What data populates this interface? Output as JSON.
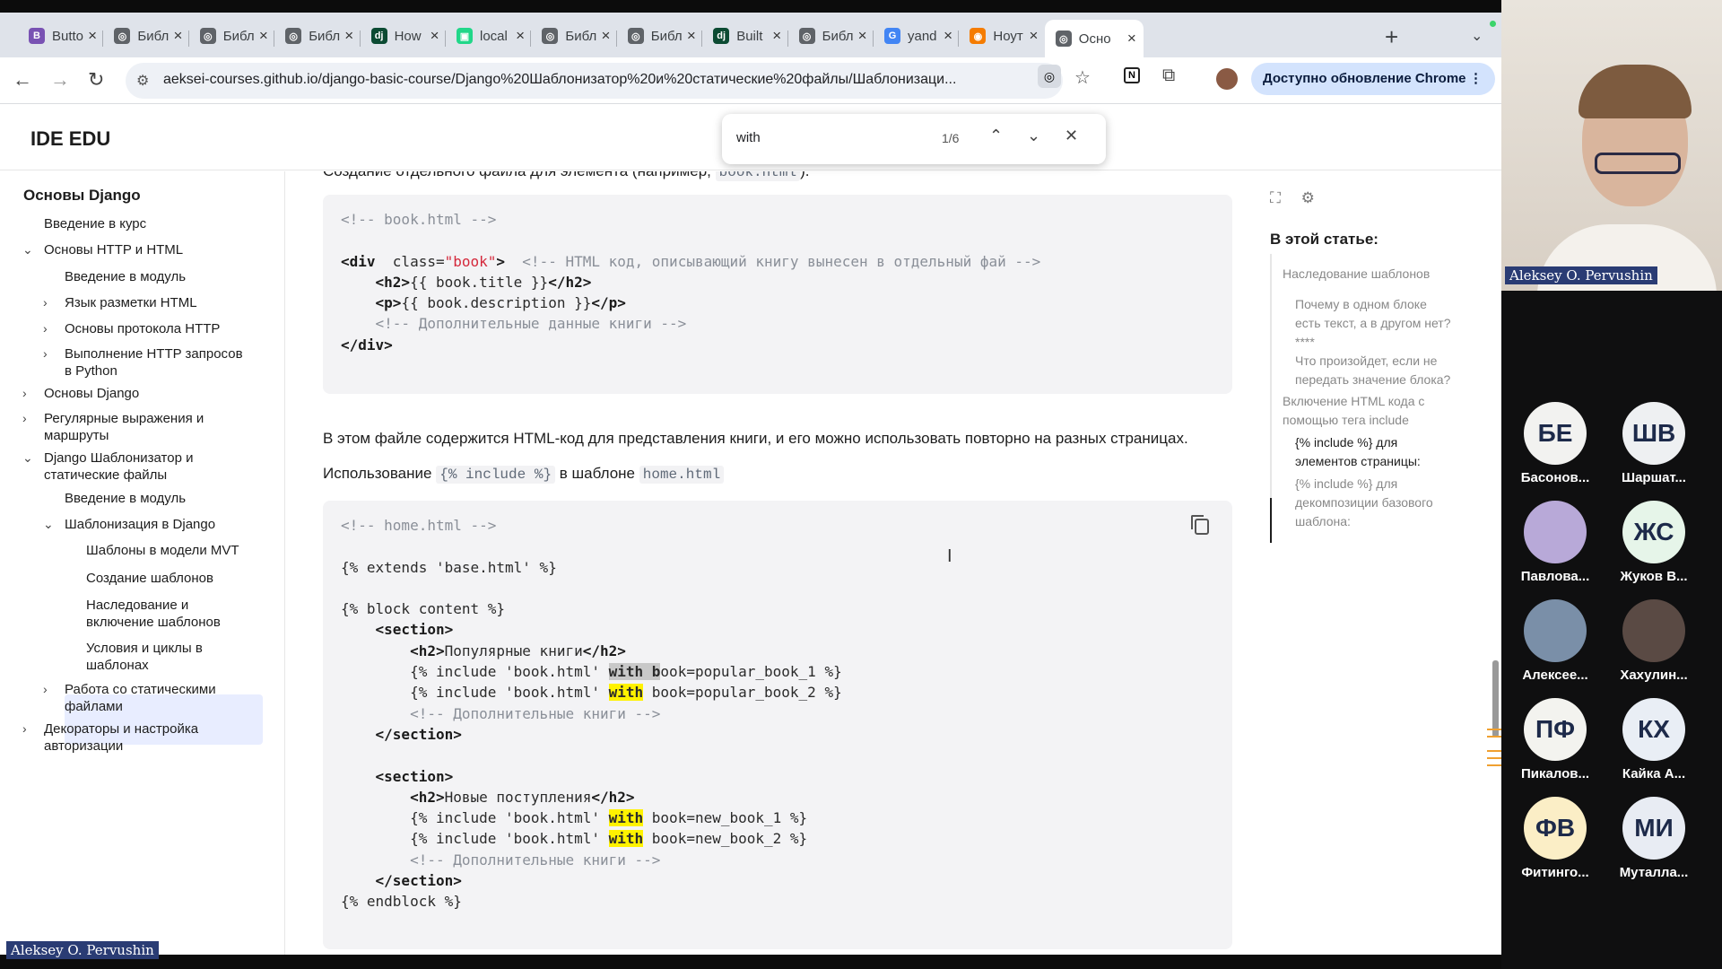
{
  "browser": {
    "tabs": [
      {
        "label": "Butto",
        "icon": "bootstrap-icon",
        "color": "#7952b3",
        "glyph": "B"
      },
      {
        "label": "Библ",
        "icon": "globe-icon",
        "color": "#5f6368",
        "glyph": "◎"
      },
      {
        "label": "Библ",
        "icon": "globe-icon",
        "color": "#5f6368",
        "glyph": "◎"
      },
      {
        "label": "Библ",
        "icon": "globe-icon",
        "color": "#5f6368",
        "glyph": "◎"
      },
      {
        "label": "How",
        "icon": "django-icon",
        "color": "#0c4b33",
        "glyph": "dj"
      },
      {
        "label": "local",
        "icon": "pycharm-icon",
        "color": "#21d789",
        "glyph": "▣"
      },
      {
        "label": "Библ",
        "icon": "globe-icon",
        "color": "#5f6368",
        "glyph": "◎"
      },
      {
        "label": "Библ",
        "icon": "globe-icon",
        "color": "#5f6368",
        "glyph": "◎"
      },
      {
        "label": "Built",
        "icon": "django-icon",
        "color": "#0c4b33",
        "glyph": "dj"
      },
      {
        "label": "Библ",
        "icon": "globe-icon",
        "color": "#5f6368",
        "glyph": "◎"
      },
      {
        "label": "yand",
        "icon": "google-icon",
        "color": "#4285f4",
        "glyph": "G"
      },
      {
        "label": "Ноут",
        "icon": "notebook-icon",
        "color": "#f57c00",
        "glyph": "◉"
      },
      {
        "label": "Осно",
        "icon": "globe-icon",
        "color": "#5f6368",
        "glyph": "◎",
        "active": true
      }
    ],
    "url": "aeksei-courses.github.io/django-basic-course/Django%20Шаблонизатор%20и%20статические%20файлы/Шаблонизаци...",
    "update_label": "Доступно обновление Chrome",
    "find": {
      "query": "with",
      "count": "1/6"
    }
  },
  "site": {
    "brand": "IDE EDU"
  },
  "sidebar": {
    "items": [
      {
        "label": "Основы Django",
        "level": 0,
        "chev": ""
      },
      {
        "label": "Введение в курс",
        "level": 1,
        "chev": ""
      },
      {
        "label": "Основы HTTP и HTML",
        "level": 1,
        "chev": "⌄"
      },
      {
        "label": "Введение в модуль",
        "level": 2,
        "chev": ""
      },
      {
        "label": "Язык разметки HTML",
        "level": 2,
        "chev": "›"
      },
      {
        "label": "Основы протокола HTTP",
        "level": 2,
        "chev": "›"
      },
      {
        "label": "Выполнение HTTP запросов\nв Python",
        "level": 2,
        "chev": "›"
      },
      {
        "label": "Основы Django",
        "level": 1,
        "chev": "›"
      },
      {
        "label": "Регулярные выражения и\nмаршруты",
        "level": 1,
        "chev": "›"
      },
      {
        "label": "Django Шаблонизатор и\nстатические файлы",
        "level": 1,
        "chev": "⌄"
      },
      {
        "label": "Введение в модуль",
        "level": 2,
        "chev": ""
      },
      {
        "label": "Шаблонизация в Django",
        "level": 2,
        "chev": "⌄"
      },
      {
        "label": "Шаблоны в модели MVT",
        "level": 3,
        "chev": ""
      },
      {
        "label": "Создание шаблонов",
        "level": 3,
        "chev": ""
      },
      {
        "label": "Наследование и\nвключение шаблонов",
        "level": 3,
        "chev": "",
        "active": true
      },
      {
        "label": "Условия и циклы в\nшаблонах",
        "level": 3,
        "chev": ""
      },
      {
        "label": "Работа со статическими\nфайлами",
        "level": 2,
        "chev": "›"
      },
      {
        "label": "Декораторы и настройка\nавторизации",
        "level": 1,
        "chev": "›"
      }
    ]
  },
  "content": {
    "top_cut": "Создание отдельного файла для элемента (например,",
    "top_cut_code": "book.html",
    "top_cut_end": ").",
    "para1": "В этом файле содержится HTML-код для представления книги, и его можно использовать повторно на разных страницах.",
    "para2_pre": "Использование",
    "para2_code": "{% include %}",
    "para2_mid": "в шаблоне",
    "para2_code2": "home.html",
    "code1": [
      [
        [
          "cm",
          "<!-- book.html -->"
        ]
      ],
      [],
      [
        [
          "tg",
          "<div"
        ],
        [
          "",
          "  class="
        ],
        [
          "str",
          "\"book\""
        ],
        [
          "tg",
          ">"
        ],
        [
          "",
          "  "
        ],
        [
          "cm",
          "<!-- HTML код, описывающий книгу вынесен в отдельный фай -->"
        ]
      ],
      [
        [
          "",
          "    "
        ],
        [
          "tg",
          "<h2>"
        ],
        [
          "",
          "{{ book.title }}"
        ],
        [
          "tg",
          "</h2>"
        ]
      ],
      [
        [
          "",
          "    "
        ],
        [
          "tg",
          "<p>"
        ],
        [
          "",
          "{{ book.description }}"
        ],
        [
          "tg",
          "</p>"
        ]
      ],
      [
        [
          "",
          "    "
        ],
        [
          "cm",
          "<!-- Дополнительные данные книги -->"
        ]
      ],
      [
        [
          "tg",
          "</div>"
        ]
      ]
    ],
    "code2": [
      [
        [
          "cm",
          "<!-- home.html -->"
        ]
      ],
      [],
      [
        [
          "",
          "{% extends 'base.html' %}"
        ]
      ],
      [],
      [
        [
          "",
          "{% block content %}"
        ]
      ],
      [
        [
          "",
          "    "
        ],
        [
          "tg",
          "<section>"
        ]
      ],
      [
        [
          "",
          "        "
        ],
        [
          "tg",
          "<h2>"
        ],
        [
          "",
          "Популярные книги"
        ],
        [
          "tg",
          "</h2>"
        ]
      ],
      [
        [
          "",
          "        {% include 'book.html' "
        ],
        [
          "hl-cur",
          "with b"
        ],
        [
          "",
          "ook=popular_book_1 %}"
        ]
      ],
      [
        [
          "",
          "        {% include 'book.html' "
        ],
        [
          "hl",
          "with"
        ],
        [
          "",
          " book=popular_book_2 %}"
        ]
      ],
      [
        [
          "",
          "        "
        ],
        [
          "cm",
          "<!-- Дополнительные книги -->"
        ]
      ],
      [
        [
          "",
          "    "
        ],
        [
          "tg",
          "</section>"
        ]
      ],
      [],
      [
        [
          "",
          "    "
        ],
        [
          "tg",
          "<section>"
        ]
      ],
      [
        [
          "",
          "        "
        ],
        [
          "tg",
          "<h2>"
        ],
        [
          "",
          "Новые поступления"
        ],
        [
          "tg",
          "</h2>"
        ]
      ],
      [
        [
          "",
          "        {% include 'book.html' "
        ],
        [
          "hl",
          "with"
        ],
        [
          "",
          " book=new_book_1 %}"
        ]
      ],
      [
        [
          "",
          "        {% include 'book.html' "
        ],
        [
          "hl",
          "with"
        ],
        [
          "",
          " book=new_book_2 %}"
        ]
      ],
      [
        [
          "",
          "        "
        ],
        [
          "cm",
          "<!-- Дополнительные книги -->"
        ]
      ],
      [
        [
          "",
          "    "
        ],
        [
          "tg",
          "</section>"
        ]
      ],
      [
        [
          "",
          "{% endblock %}"
        ]
      ]
    ]
  },
  "toc": {
    "title": "В этой статье:",
    "items": [
      {
        "label": "Наследование шаблонов",
        "level": 0
      },
      {
        "label": "Почему в одном блоке\nесть текст, а в другом нет?\n****",
        "level": 1
      },
      {
        "label": "Что произойдет, если не\nпередать значение блока?",
        "level": 1
      },
      {
        "label": "Включение HTML кода с\nпомощью тега include",
        "level": 0
      },
      {
        "label": "{% include %} для\nэлементов страницы:",
        "level": 1,
        "active": true
      },
      {
        "label": "{% include %} для\nдекомпозиции базового\nшаблона:",
        "level": 1
      }
    ]
  },
  "call": {
    "speaker": "Aleksey O. Pervushin",
    "presenter": "Aleksey O. Pervushin",
    "participants": [
      {
        "initials": "БЕ",
        "name": "Басонов...",
        "color": "#f2f2f0"
      },
      {
        "initials": "ШВ",
        "name": "Шаршат...",
        "color": "#eef0f2"
      },
      {
        "initials": "",
        "name": "Павлова...",
        "color": "#b8a9d8",
        "photo": true
      },
      {
        "initials": "ЖС",
        "name": "Жуков В...",
        "color": "#e6f5e9"
      },
      {
        "initials": "",
        "name": "Алексее...",
        "color": "#7a8fa8",
        "photo": true
      },
      {
        "initials": "",
        "name": "Хахулин...",
        "color": "#5a4a44",
        "photo": true
      },
      {
        "initials": "ПФ",
        "name": "Пикалов...",
        "color": "#f3f3ef"
      },
      {
        "initials": "КХ",
        "name": "Кайка А...",
        "color": "#e9eef5"
      },
      {
        "initials": "ФВ",
        "name": "Фитинго...",
        "color": "#fbeec6"
      },
      {
        "initials": "МИ",
        "name": "Муталла...",
        "color": "#e8ecf3"
      }
    ]
  }
}
